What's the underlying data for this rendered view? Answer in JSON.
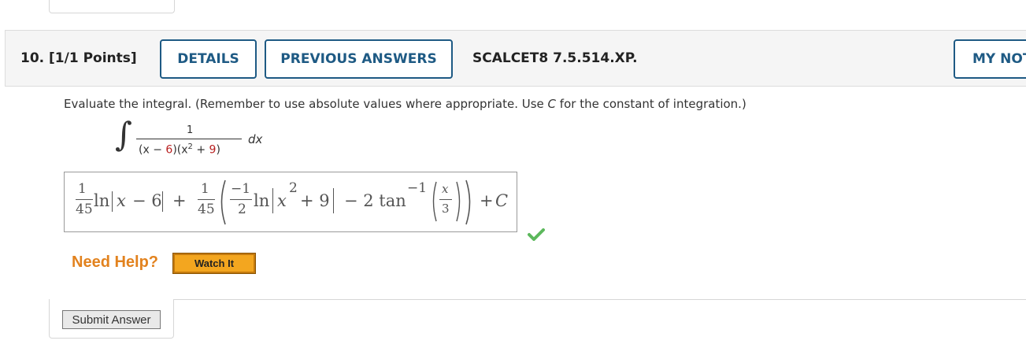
{
  "question": {
    "number_points": "10.  [1/1 Points]",
    "details_label": "DETAILS",
    "previous_answers_label": "PREVIOUS ANSWERS",
    "assignment_code": "SCALCET8 7.5.514.XP.",
    "my_notes_label": "MY NOTES"
  },
  "prompt": {
    "part1": "Evaluate the integral. (Remember to use absolute values where appropriate. Use ",
    "var": "C",
    "part2": " for the constant of integration.)"
  },
  "integral": {
    "sign": "∫",
    "numerator": "1",
    "den_a": "(x − ",
    "den_b": "6",
    "den_c": ")(x",
    "den_exp": "2",
    "den_d": " + ",
    "den_e": "9",
    "den_f": ")",
    "differential": "dx"
  },
  "answer": {
    "c1_num": "1",
    "c1_den": "45",
    "ln1": "ln",
    "x1": "x",
    "minus6": "− 6",
    "plus1": "+",
    "c2_num": "1",
    "c2_den": "45",
    "c3_num": "−1",
    "c3_den": "2",
    "ln2": "ln",
    "x2": "x",
    "exp2": "2",
    "plus9": "+ 9",
    "minus_2tan": "− 2 tan",
    "exp_neg1": "−1",
    "arg_num": "x",
    "arg_den": "3",
    "plus_c": "+",
    "c": "C",
    "status": "correct"
  },
  "help": {
    "need_help": "Need Help?",
    "watch_it": "Watch It"
  },
  "footer": {
    "submit_label": "Submit Answer"
  },
  "colors": {
    "accent": "#1e5a84",
    "help_orange": "#e2821e",
    "watch_bg": "#f3a61f",
    "check_green": "#5cb85c",
    "red": "#b82020"
  }
}
